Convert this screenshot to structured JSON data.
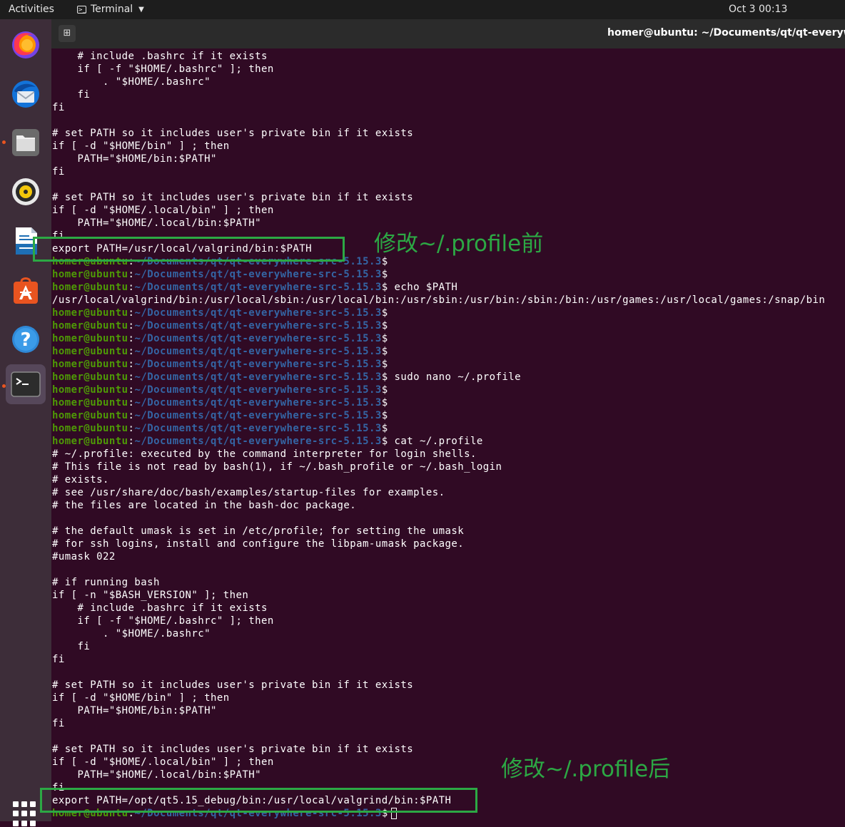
{
  "topbar": {
    "activities": "Activities",
    "app": "Terminal",
    "clock": "Oct 3  00:13"
  },
  "dock": {
    "items": [
      {
        "name": "firefox-icon",
        "running": false,
        "active": false
      },
      {
        "name": "thunderbird-icon",
        "running": false,
        "active": false
      },
      {
        "name": "files-icon",
        "running": true,
        "active": false
      },
      {
        "name": "rhythmbox-icon",
        "running": false,
        "active": false
      },
      {
        "name": "libreoffice-writer-icon",
        "running": false,
        "active": false
      },
      {
        "name": "software-center-icon",
        "running": false,
        "active": false
      },
      {
        "name": "help-icon",
        "running": false,
        "active": false
      },
      {
        "name": "terminal-icon",
        "running": true,
        "active": true
      }
    ],
    "show_apps_icon": "grid-icon"
  },
  "window": {
    "title": "homer@ubuntu: ~/Documents/qt/qt-everywhe"
  },
  "prompt": {
    "user": "homer@ubuntu",
    "sep": ":",
    "path": "~/Documents/qt/qt-everywhere-src-5.15.3",
    "symbol": "$"
  },
  "terminal_lines": [
    {
      "text": "    # include .bashrc if it exists"
    },
    {
      "text": "    if [ -f \"$HOME/.bashrc\" ]; then"
    },
    {
      "text": "        . \"$HOME/.bashrc\""
    },
    {
      "text": "    fi"
    },
    {
      "text": "fi"
    },
    {
      "text": ""
    },
    {
      "text": "# set PATH so it includes user's private bin if it exists"
    },
    {
      "text": "if [ -d \"$HOME/bin\" ] ; then"
    },
    {
      "text": "    PATH=\"$HOME/bin:$PATH\""
    },
    {
      "text": "fi"
    },
    {
      "text": ""
    },
    {
      "text": "# set PATH so it includes user's private bin if it exists"
    },
    {
      "text": "if [ -d \"$HOME/.local/bin\" ] ; then"
    },
    {
      "text": "    PATH=\"$HOME/.local/bin:$PATH\""
    },
    {
      "text": "fi"
    },
    {
      "text": "export PATH=/usr/local/valgrind/bin:$PATH"
    },
    {
      "prompt": true,
      "cmd": ""
    },
    {
      "prompt": true,
      "cmd": ""
    },
    {
      "prompt": true,
      "cmd": " echo $PATH"
    },
    {
      "text": "/usr/local/valgrind/bin:/usr/local/sbin:/usr/local/bin:/usr/sbin:/usr/bin:/sbin:/bin:/usr/games:/usr/local/games:/snap/bin"
    },
    {
      "prompt": true,
      "cmd": ""
    },
    {
      "prompt": true,
      "cmd": ""
    },
    {
      "prompt": true,
      "cmd": ""
    },
    {
      "prompt": true,
      "cmd": ""
    },
    {
      "prompt": true,
      "cmd": ""
    },
    {
      "prompt": true,
      "cmd": " sudo nano ~/.profile"
    },
    {
      "prompt": true,
      "cmd": ""
    },
    {
      "prompt": true,
      "cmd": ""
    },
    {
      "prompt": true,
      "cmd": ""
    },
    {
      "prompt": true,
      "cmd": ""
    },
    {
      "prompt": true,
      "cmd": " cat ~/.profile"
    },
    {
      "text": "# ~/.profile: executed by the command interpreter for login shells."
    },
    {
      "text": "# This file is not read by bash(1), if ~/.bash_profile or ~/.bash_login"
    },
    {
      "text": "# exists."
    },
    {
      "text": "# see /usr/share/doc/bash/examples/startup-files for examples."
    },
    {
      "text": "# the files are located in the bash-doc package."
    },
    {
      "text": ""
    },
    {
      "text": "# the default umask is set in /etc/profile; for setting the umask"
    },
    {
      "text": "# for ssh logins, install and configure the libpam-umask package."
    },
    {
      "text": "#umask 022"
    },
    {
      "text": ""
    },
    {
      "text": "# if running bash"
    },
    {
      "text": "if [ -n \"$BASH_VERSION\" ]; then"
    },
    {
      "text": "    # include .bashrc if it exists"
    },
    {
      "text": "    if [ -f \"$HOME/.bashrc\" ]; then"
    },
    {
      "text": "        . \"$HOME/.bashrc\""
    },
    {
      "text": "    fi"
    },
    {
      "text": "fi"
    },
    {
      "text": ""
    },
    {
      "text": "# set PATH so it includes user's private bin if it exists"
    },
    {
      "text": "if [ -d \"$HOME/bin\" ] ; then"
    },
    {
      "text": "    PATH=\"$HOME/bin:$PATH\""
    },
    {
      "text": "fi"
    },
    {
      "text": ""
    },
    {
      "text": "# set PATH so it includes user's private bin if it exists"
    },
    {
      "text": "if [ -d \"$HOME/.local/bin\" ] ; then"
    },
    {
      "text": "    PATH=\"$HOME/.local/bin:$PATH\""
    },
    {
      "text": "fi"
    },
    {
      "text": "export PATH=/opt/qt5.15_debug/bin:/usr/local/valgrind/bin:$PATH"
    },
    {
      "prompt": true,
      "cmd": "",
      "cursor": true
    }
  ],
  "annotations": {
    "before": "修改~/.profile前",
    "after": "修改~/.profile后"
  },
  "colors": {
    "terminal_bg": "#300a24",
    "prompt_user": "#4e9a06",
    "prompt_path": "#3465a4",
    "highlight": "#2ca844",
    "topbar": "#1d1d1d",
    "dock": "#3d2d39"
  }
}
